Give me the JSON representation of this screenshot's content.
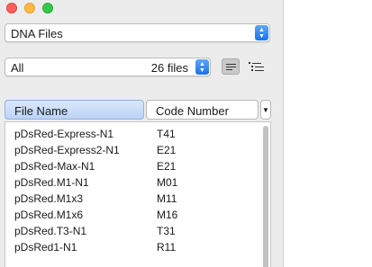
{
  "window": {
    "controls": [
      "close",
      "minimize",
      "maximize"
    ]
  },
  "dna_selector": {
    "value": "DNA Files"
  },
  "filter": {
    "value": "All",
    "count": "26 files"
  },
  "view_buttons": {
    "list_view_icon": "list-view-icon",
    "detail_view_icon": "detail-list-icon"
  },
  "columns": {
    "file_name": "File Name",
    "code_number": "Code Number"
  },
  "files": [
    {
      "name": "pDsRed-Express-N1",
      "code": "T41"
    },
    {
      "name": "pDsRed-Express2-N1",
      "code": "E21"
    },
    {
      "name": "pDsRed-Max-N1",
      "code": "E21"
    },
    {
      "name": "pDsRed.M1-N1",
      "code": "M01"
    },
    {
      "name": "pDsRed.M1x3",
      "code": "M11"
    },
    {
      "name": "pDsRed.M1x6",
      "code": "M16"
    },
    {
      "name": "pDsRed.T3-N1",
      "code": "T31"
    },
    {
      "name": "pDsRed1-N1",
      "code": "R11"
    }
  ],
  "colors": {
    "accent": "#1a73e8",
    "header_selected": "#bcd4f6"
  }
}
